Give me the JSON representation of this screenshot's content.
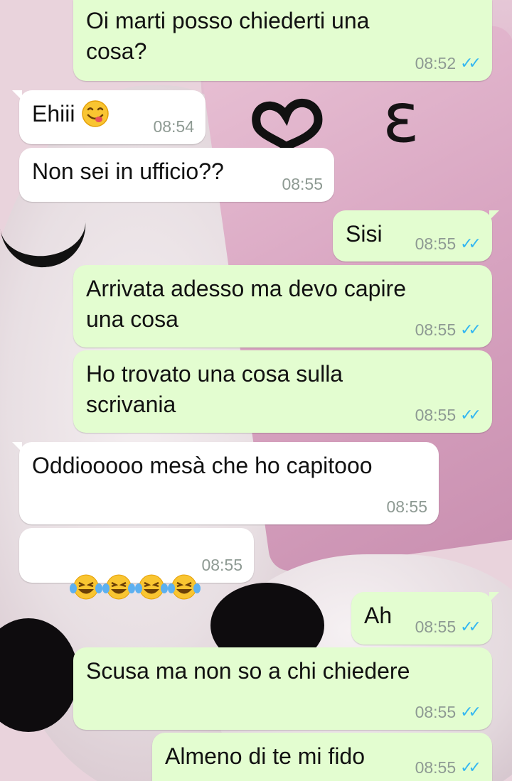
{
  "colors": {
    "outgoing_bubble": "#e3fdd0",
    "incoming_bubble": "#ffffff",
    "timestamp": "#8e9a93",
    "read_ticks": "#34b7f1"
  },
  "wallpaper": {
    "symbols": "ɛ"
  },
  "messages": [
    {
      "direction": "outgoing",
      "text": "Oi marti posso chiederti una\ncosa?",
      "time": "08:52",
      "ticks": "double-blue-check"
    },
    {
      "direction": "incoming",
      "text": "Ehiii",
      "emoji": "face-savoring-food-icon",
      "time": "08:54"
    },
    {
      "direction": "incoming",
      "text": "Non sei in ufficio??",
      "time": "08:55"
    },
    {
      "direction": "outgoing",
      "text": "Sisi",
      "time": "08:55",
      "ticks": "double-blue-check"
    },
    {
      "direction": "outgoing",
      "text": "Arrivata adesso ma devo capire\nuna cosa",
      "time": "08:55",
      "ticks": "double-blue-check"
    },
    {
      "direction": "outgoing",
      "text": "Ho trovato una cosa sulla\nscrivania",
      "time": "08:55",
      "ticks": "double-blue-check"
    },
    {
      "direction": "incoming",
      "text": "Oddiooooo mesà che ho capitooo",
      "time": "08:55"
    },
    {
      "direction": "incoming",
      "text": "",
      "emoji": "tears-of-joy-icon x4",
      "time": "08:55"
    },
    {
      "direction": "outgoing",
      "text": "Ah",
      "time": "08:55",
      "ticks": "double-blue-check"
    },
    {
      "direction": "outgoing",
      "text": "Scusa ma non so a chi chiedere",
      "time": "08:55",
      "ticks": "double-blue-check"
    },
    {
      "direction": "outgoing",
      "text": "Almeno di te mi fido",
      "time": "08:55",
      "ticks": "double-blue-check"
    }
  ]
}
